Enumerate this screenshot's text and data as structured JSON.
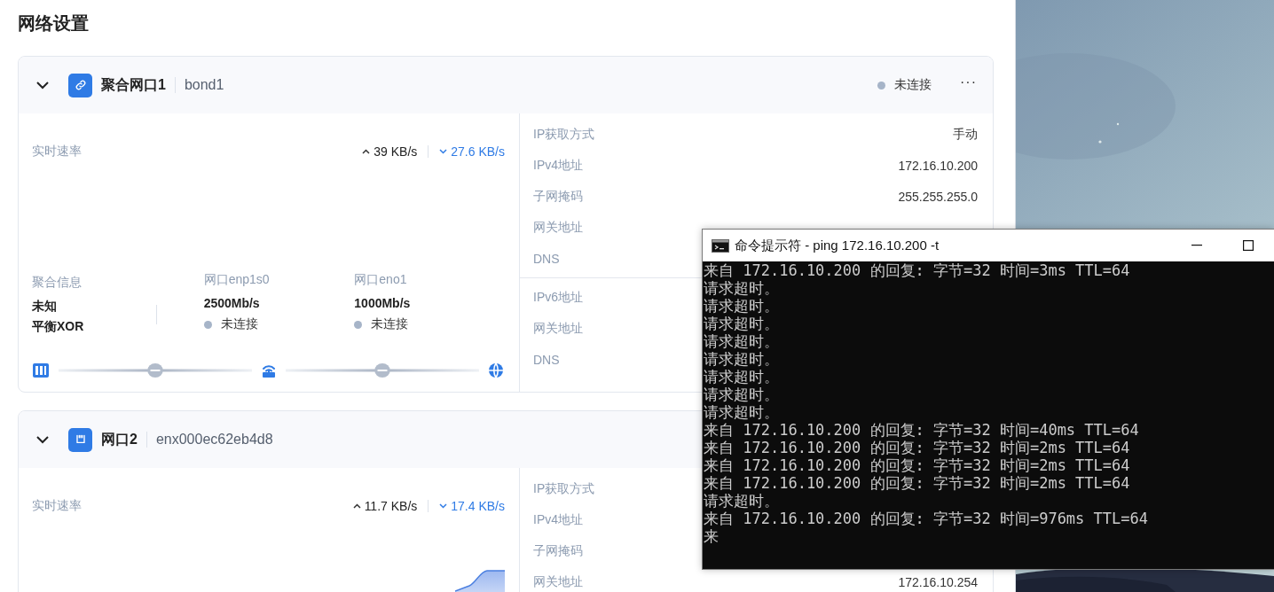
{
  "page_title": "网络设置",
  "interfaces": [
    {
      "kind": "bond",
      "expanded": true,
      "name": "聚合网口1",
      "device": "bond1",
      "status": {
        "text": "未连接",
        "connected": false
      },
      "more": "···",
      "rate": {
        "label": "实时速率",
        "up": "39 KB/s",
        "down": "27.6 KB/s"
      },
      "bond_info": {
        "label": "聚合信息",
        "values": [
          "未知",
          "平衡XOR"
        ]
      },
      "ports": [
        {
          "name": "网口enp1s0",
          "speed": "2500Mb/s",
          "status": "未连接",
          "connected": false
        },
        {
          "name": "网口eno1",
          "speed": "1000Mb/s",
          "status": "未连接",
          "connected": false
        }
      ],
      "ipv4": [
        {
          "label": "IP获取方式",
          "value": "手动"
        },
        {
          "label": "IPv4地址",
          "value": "172.16.10.200"
        },
        {
          "label": "子网掩码",
          "value": "255.255.255.0"
        },
        {
          "label": "网关地址"
        },
        {
          "label": "DNS"
        }
      ],
      "ipv6": [
        {
          "label": "IPv6地址"
        },
        {
          "label": "网关地址"
        },
        {
          "label": "DNS"
        }
      ]
    },
    {
      "kind": "port",
      "expanded": true,
      "name": "网口2",
      "device": "enx000ec62eb4d8",
      "rate": {
        "label": "实时速率",
        "up": "11.7 KB/s",
        "down": "17.4 KB/s"
      },
      "ipv4": [
        {
          "label": "IP获取方式"
        },
        {
          "label": "IPv4地址"
        },
        {
          "label": "子网掩码"
        },
        {
          "label": "网关地址",
          "value": "172.16.10.254"
        }
      ]
    }
  ],
  "terminal": {
    "title": "命令提示符 - ping  172.16.10.200 -t",
    "lines": [
      "来自 172.16.10.200 的回复: 字节=32 时间=3ms TTL=64",
      "请求超时。",
      "请求超时。",
      "请求超时。",
      "请求超时。",
      "请求超时。",
      "请求超时。",
      "请求超时。",
      "请求超时。",
      "来自 172.16.10.200 的回复: 字节=32 时间=40ms TTL=64",
      "来自 172.16.10.200 的回复: 字节=32 时间=2ms TTL=64",
      "来自 172.16.10.200 的回复: 字节=32 时间=2ms TTL=64",
      "来自 172.16.10.200 的回复: 字节=32 时间=2ms TTL=64",
      "请求超时。",
      "来自 172.16.10.200 的回复: 字节=32 时间=976ms TTL=64",
      "来"
    ]
  }
}
